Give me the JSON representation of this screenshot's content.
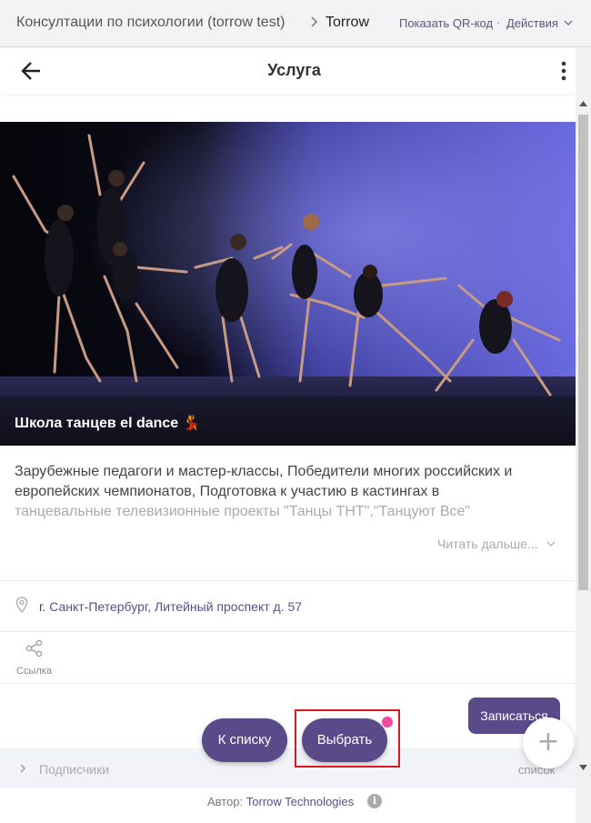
{
  "breadcrumb": {
    "parent": "Консултации по психологии (torrow test)",
    "current": "Torrow",
    "show_qr": "Показать QR-код",
    "separator": "·",
    "actions": "Действия"
  },
  "header": {
    "title": "Услуга"
  },
  "service": {
    "title": "Школа танцев el dance 💃",
    "description_line1": "Зарубежные педагоги и мастер-классы, Победители многих российских и",
    "description_line2": "европейских чемпионатов, Подготовка к участию в кастингах в",
    "description_line3": "танцевальные телевизионные проекты \"Танцы ТНТ\",\"Танцуют Все\"",
    "read_more": "Читать дальше...",
    "address_city": "г.",
    "address_rest": "Санкт-Петербург, Литейный проспект д. 57",
    "share_label": "Ссылка",
    "signup_label": "Записаться"
  },
  "subscribers": {
    "label": "Подписчики",
    "list_label": "список"
  },
  "footer": {
    "author_prefix": "Автор:",
    "author_name": "Torrow Technologies",
    "info_glyph": "i"
  },
  "floating": {
    "to_list_label": "К списку",
    "choose_label": "Выбрать",
    "fab_glyph": "+"
  },
  "colors": {
    "accent": "#5a4a8a",
    "highlight": "#e0161f",
    "notify": "#f04a9c",
    "link": "#5a4d8e"
  },
  "icons": {
    "back": "arrow-left-icon",
    "more": "kebab-menu-icon",
    "location": "map-pin-icon",
    "share": "share-icon",
    "info": "info-icon",
    "add": "plus-icon"
  }
}
